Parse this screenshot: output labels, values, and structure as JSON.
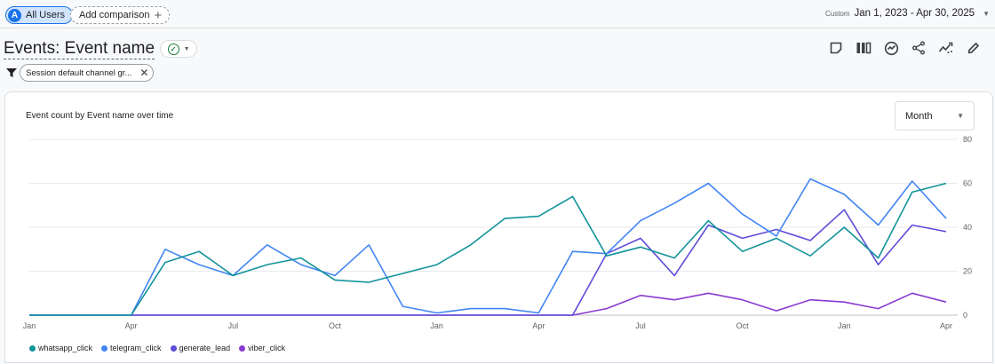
{
  "topbar": {
    "user_chip": {
      "avatar_letter": "A",
      "label": "All Users"
    },
    "add_comparison": {
      "label": "Add comparison",
      "icon": "plus-icon"
    },
    "date_range": {
      "custom_label": "Custom",
      "value": "Jan 1, 2023 - Apr 30, 2025",
      "icon": "caret-down-icon"
    }
  },
  "header": {
    "title": "Events: Event name",
    "status_icon": "check-circle-icon",
    "tool_icons": [
      "note-icon",
      "compare-icon",
      "insights-icon",
      "share-icon",
      "trend-icon",
      "edit-icon"
    ]
  },
  "filter": {
    "icon": "filter-icon",
    "label": "Session default channel gr...",
    "remove_icon": "close-icon"
  },
  "card": {
    "title": "Event count by Event name over time",
    "granularity": {
      "selected": "Month",
      "icon": "caret-down-icon"
    }
  },
  "chart_data": {
    "type": "line",
    "title": "Event count by Event name over time",
    "x": [
      "Jan 2023",
      "Feb 2023",
      "Mar 2023",
      "Apr 2023",
      "May 2023",
      "Jun 2023",
      "Jul 2023",
      "Aug 2023",
      "Sep 2023",
      "Oct 2023",
      "Nov 2023",
      "Dec 2023",
      "Jan 2024",
      "Feb 2024",
      "Mar 2024",
      "Apr 2024",
      "May 2024",
      "Jun 2024",
      "Jul 2024",
      "Aug 2024",
      "Sep 2024",
      "Oct 2024",
      "Nov 2024",
      "Dec 2024",
      "Jan 2025",
      "Feb 2025",
      "Mar 2025",
      "Apr 2025"
    ],
    "x_tick_labels": [
      "Jan",
      "Apr",
      "Jul",
      "Oct",
      "Jan",
      "Apr",
      "Jul",
      "Oct",
      "Jan",
      "Apr"
    ],
    "x_tick_index": [
      0,
      3,
      6,
      9,
      12,
      15,
      18,
      21,
      24,
      27
    ],
    "y_ticks": [
      0,
      20,
      40,
      60,
      80
    ],
    "ylim": [
      0,
      80
    ],
    "grid": true,
    "legend_position": "bottom-left",
    "series": [
      {
        "name": "whatsapp_click",
        "color": "#12939a",
        "values": [
          0,
          0,
          0,
          0,
          24,
          29,
          18,
          23,
          26,
          16,
          15,
          19,
          23,
          32,
          44,
          45,
          54,
          27,
          31,
          26,
          43,
          29,
          35,
          27,
          40,
          26,
          56,
          60
        ]
      },
      {
        "name": "telegram_click",
        "color": "#4285f4",
        "values": [
          0,
          0,
          0,
          0,
          30,
          23,
          18,
          32,
          23,
          18,
          32,
          4,
          1,
          3,
          3,
          1,
          29,
          28,
          43,
          51,
          60,
          46,
          36,
          62,
          55,
          41,
          61,
          44
        ]
      },
      {
        "name": "generate_lead",
        "color": "#5c4dd8",
        "values": [
          0,
          0,
          0,
          0,
          0,
          0,
          0,
          0,
          0,
          0,
          0,
          0,
          0,
          0,
          0,
          0,
          0,
          28,
          35,
          18,
          41,
          35,
          39,
          34,
          48,
          23,
          41,
          38
        ]
      },
      {
        "name": "viber_click",
        "color": "#8a3bd1",
        "values": [
          0,
          0,
          0,
          0,
          0,
          0,
          0,
          0,
          0,
          0,
          0,
          0,
          0,
          0,
          0,
          0,
          0,
          3,
          9,
          7,
          10,
          7,
          2,
          7,
          6,
          3,
          10,
          6
        ]
      }
    ]
  }
}
